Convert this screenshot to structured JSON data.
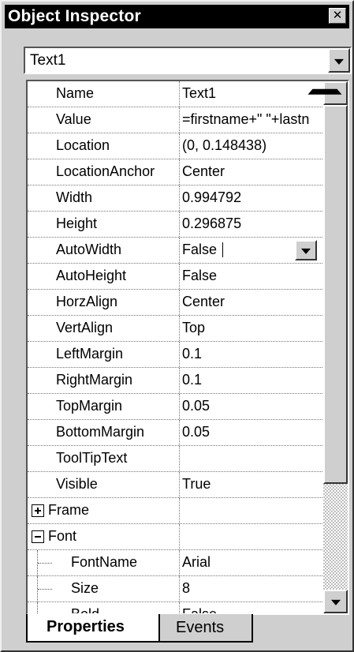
{
  "window": {
    "title": "Object Inspector",
    "close_glyph": "✕"
  },
  "object_selector": {
    "value": "Text1"
  },
  "properties": [
    {
      "name": "Name",
      "value": "Text1"
    },
    {
      "name": "Value",
      "value": "=firstname+\" \"+lastn"
    },
    {
      "name": "Location",
      "value": "(0, 0.148438)"
    },
    {
      "name": "LocationAnchor",
      "value": "Center"
    },
    {
      "name": "Width",
      "value": "0.994792"
    },
    {
      "name": "Height",
      "value": "0.296875"
    },
    {
      "name": "AutoWidth",
      "value": "False"
    },
    {
      "name": "AutoHeight",
      "value": "False"
    },
    {
      "name": "HorzAlign",
      "value": "Center"
    },
    {
      "name": "VertAlign",
      "value": "Top"
    },
    {
      "name": "LeftMargin",
      "value": "0.1"
    },
    {
      "name": "RightMargin",
      "value": "0.1"
    },
    {
      "name": "TopMargin",
      "value": "0.05"
    },
    {
      "name": "BottomMargin",
      "value": "0.05"
    },
    {
      "name": "ToolTipText",
      "value": ""
    },
    {
      "name": "Visible",
      "value": "True"
    },
    {
      "name": "Frame",
      "value": ""
    },
    {
      "name": "Font",
      "value": ""
    },
    {
      "name": "FontName",
      "value": "Arial"
    },
    {
      "name": "Size",
      "value": "8"
    },
    {
      "name": "Bold",
      "value": "False"
    }
  ],
  "tabs": [
    {
      "label": "Properties",
      "active": true
    },
    {
      "label": "Events",
      "active": false
    }
  ],
  "icons": {
    "close": "close-icon",
    "dropdown": "chevron-down-icon",
    "scroll_up": "scroll-up-arrow-icon",
    "scroll_down": "scroll-down-arrow-icon",
    "expand": "plus-box-icon",
    "collapse": "minus-box-icon"
  },
  "colors": {
    "titlebar": "#000000",
    "panel": "#cfcfcf",
    "grid": "#ffffff"
  }
}
